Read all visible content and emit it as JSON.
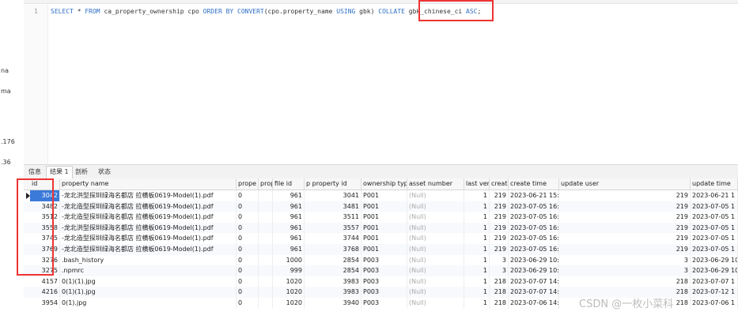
{
  "sidebar": {
    "fragments": [
      "na",
      "ma",
      ".176",
      ".36"
    ]
  },
  "editor": {
    "line_number": "1",
    "sql": {
      "select": "SELECT",
      "star": " * ",
      "from": "FROM",
      "table_alias": " ca_property_ownership cpo ",
      "order_by": "ORDER BY",
      "convert": " CONVERT",
      "convert_args_1": "(cpo.property_name ",
      "using": "USING",
      "convert_args_2": " gbk) ",
      "collate": "COLLATE",
      "collation": " gbk_chinese_ci ",
      "asc": "ASC",
      "semicolon": ";"
    }
  },
  "result_tabs": [
    "信息",
    "结果 1",
    "剖析",
    "状态"
  ],
  "grid": {
    "columns": [
      "id",
      "property name",
      "prope",
      "prop",
      "file id",
      "p property id",
      "ownership typ",
      "asset number",
      "last ver",
      "creat",
      "create time",
      "update user",
      "update time"
    ],
    "rows": [
      [
        "3042",
        "-龙北洪型探圳绿海名都店 拉横板0619-Model(1).pdf",
        "0",
        "",
        "961",
        "3041",
        "P001",
        "(Null)",
        "1",
        "219",
        "2023-06-21 15:",
        "219",
        "2023-06-21 1"
      ],
      [
        "3482",
        "-龙北造型探圳绿海名都店 拉横板0619-Model(1).pdf",
        "0",
        "",
        "961",
        "3481",
        "P001",
        "(Null)",
        "1",
        "219",
        "2023-07-05 16:",
        "219",
        "2023-07-05 1"
      ],
      [
        "3512",
        "-龙北造型探圳绿海名都店 拉横板0619-Model(1).pdf",
        "0",
        "",
        "961",
        "3511",
        "P001",
        "(Null)",
        "1",
        "219",
        "2023-07-05 16:",
        "219",
        "2023-07-05 1"
      ],
      [
        "3558",
        "-龙北洪型探圳绿海名都店 拉横板0619-Model(1).pdf",
        "0",
        "",
        "961",
        "3557",
        "P001",
        "(Null)",
        "1",
        "219",
        "2023-07-05 16:",
        "219",
        "2023-07-05 1"
      ],
      [
        "3745",
        "-龙北造型探圳绿海名都店 拉横板0619-Model(1).pdf",
        "0",
        "",
        "961",
        "3744",
        "P001",
        "(Null)",
        "1",
        "219",
        "2023-07-05 16:",
        "219",
        "2023-07-05 1"
      ],
      [
        "3769",
        "-龙北造型探圳绿海名都店 拉横板0619-Model(1).pdf",
        "0",
        "",
        "961",
        "3768",
        "P001",
        "(Null)",
        "1",
        "219",
        "2023-07-05 16:",
        "219",
        "2023-07-05 1"
      ],
      [
        "3276",
        ".bash_history",
        "0",
        "",
        "1000",
        "2854",
        "P003",
        "(Null)",
        "1",
        "3",
        "2023-06-29 10:",
        "3",
        "2023-06-29 10"
      ],
      [
        "3275",
        ".npmrc",
        "0",
        "",
        "999",
        "2854",
        "P003",
        "(Null)",
        "1",
        "3",
        "2023-06-29 10:",
        "3",
        "2023-06-29 10"
      ],
      [
        "4157",
        "0(1)(1).jpg",
        "0",
        "",
        "1020",
        "3983",
        "P003",
        "(Null)",
        "1",
        "218",
        "2023-07-07 14:",
        "218",
        "2023-07-07 1"
      ],
      [
        "4216",
        "0(1)(1).jpg",
        "0",
        "",
        "1020",
        "3983",
        "P003",
        "(Null)",
        "1",
        "218",
        "2023-07-07 14:",
        "218",
        "2023-07-12 1"
      ],
      [
        "3954",
        "0(1).jpg",
        "0",
        "",
        "1020",
        "3940",
        "P003",
        "(Null)",
        "1",
        "218",
        "2023-07-06 14:",
        "218",
        "2023-07-06 1"
      ]
    ]
  },
  "watermark": "CSDN @一枚小菜科"
}
